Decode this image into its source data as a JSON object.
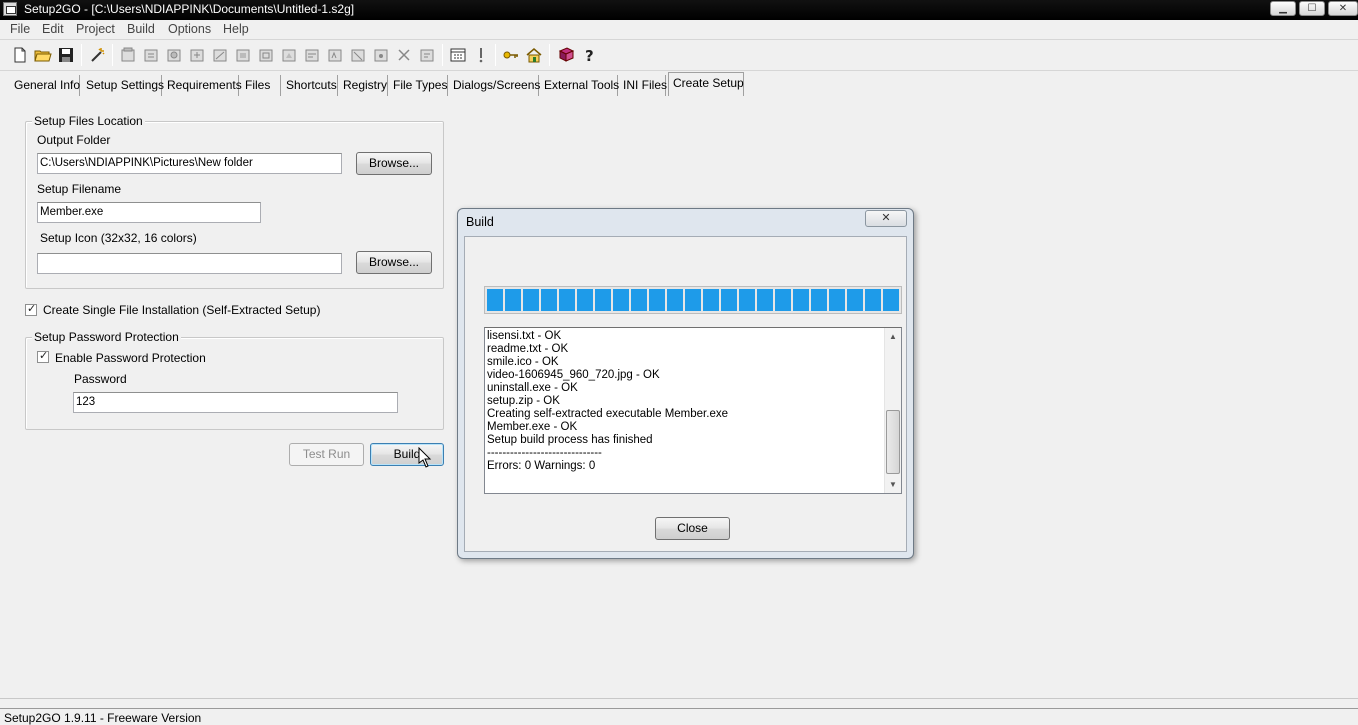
{
  "window": {
    "title": "Setup2GO - [C:\\Users\\NDIAPPINK\\Documents\\Untitled-1.s2g]"
  },
  "menu": [
    "File",
    "Edit",
    "Project",
    "Build",
    "Options",
    "Help"
  ],
  "tabs": [
    {
      "label": "General Info"
    },
    {
      "label": "Setup Settings"
    },
    {
      "label": "Requirements"
    },
    {
      "label": "Files"
    },
    {
      "label": "Shortcuts"
    },
    {
      "label": "Registry"
    },
    {
      "label": "File Types"
    },
    {
      "label": "Dialogs/Screens"
    },
    {
      "label": "External Tools"
    },
    {
      "label": "INI Files"
    },
    {
      "label": "Create Setup",
      "active": true
    }
  ],
  "location_group": {
    "title": "Setup Files Location",
    "output_folder_label": "Output Folder",
    "output_folder_value": "C:\\Users\\NDIAPPINK\\Pictures\\New folder",
    "browse_label": "Browse...",
    "setup_filename_label": "Setup Filename",
    "setup_filename_value": "Member.exe",
    "setup_icon_label": "Setup Icon (32x32, 16 colors)",
    "setup_icon_value": "",
    "browse2_label": "Browse..."
  },
  "single_file": {
    "label": "Create Single File Installation (Self-Extracted Setup)",
    "checked": true
  },
  "password_group": {
    "title": "Setup Password Protection",
    "enable_label": "Enable Password Protection",
    "enable_checked": true,
    "password_label": "Password",
    "password_value": "123"
  },
  "actions": {
    "test_run_label": "Test Run",
    "build_label": "Build"
  },
  "dialog": {
    "title": "Build",
    "close_x": "✕",
    "progress_percent": 100,
    "log_lines": [
      "lisensi.txt - OK",
      "readme.txt - OK",
      "smile.ico - OK",
      "video-1606945_960_720.jpg - OK",
      "uninstall.exe - OK",
      "setup.zip - OK",
      "Creating self-extracted executable Member.exe",
      "Member.exe - OK",
      "Setup build process has finished",
      "------------------------------",
      "Errors: 0  Warnings: 0"
    ],
    "close_label": "Close"
  },
  "status_bar": {
    "text": "Setup2GO 1.9.11 - Freeware Version"
  },
  "icons": {
    "checkmark": "✓",
    "scroll_up": "▲",
    "scroll_down": "▼",
    "minimize": "▁",
    "maximize": "☐",
    "close": "✕"
  }
}
